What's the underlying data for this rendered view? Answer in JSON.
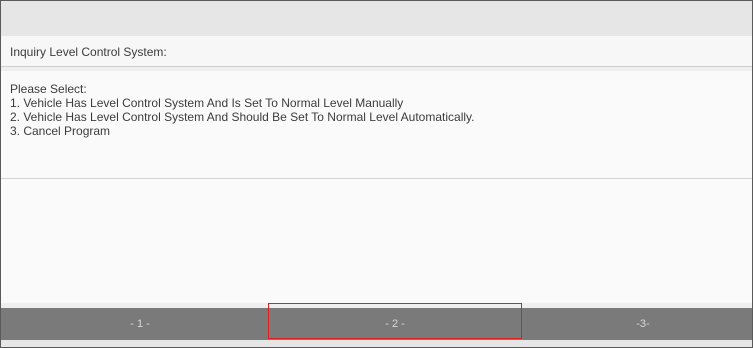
{
  "inquiry": {
    "title": "Inquiry Level Control System:"
  },
  "prompt": {
    "heading": "Please Select:",
    "options": [
      "1. Vehicle Has Level Control System And Is Set To Normal Level Manually",
      "2. Vehicle Has Level Control System And Should Be Set To Normal Level Automatically.",
      "3. Cancel Program"
    ]
  },
  "buttons": [
    {
      "label": "- 1 -"
    },
    {
      "label": "- 2 -"
    },
    {
      "label": "-3-"
    }
  ],
  "colors": {
    "highlight": "#e02020",
    "button_bar": "#7a7a7a"
  }
}
